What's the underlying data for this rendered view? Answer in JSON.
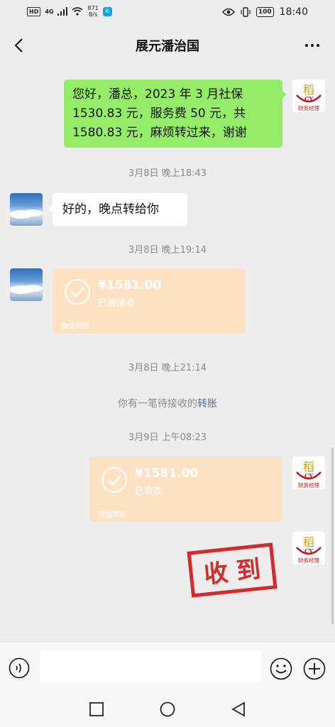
{
  "status_bar": {
    "left_badges": [
      "HD",
      "4G"
    ],
    "net_speed_value": "871",
    "net_speed_unit": "B/s",
    "battery": "100",
    "time": "18:40"
  },
  "header": {
    "title": "展元潘治国",
    "back_icon": "chevron-left-icon",
    "more_icon": "more-horizontal-icon"
  },
  "avatars": {
    "self_label": "财务经理",
    "self_logo_letters": "CY",
    "self_logo_char": "稻"
  },
  "messages": {
    "m1": {
      "line1": "您好，潘总，2023 年 3 月社保",
      "line2": "1530.83 元，服务费 50 元，共",
      "line3": "1580.83 元，麻烦转过来，谢谢"
    },
    "t1": "3月8日 晚上18:43",
    "m2": "好的，晚点转给你",
    "t2": "3月8日 晚上19:14",
    "transfer1": {
      "amount": "¥1581.00",
      "status": "已被接收",
      "footer": "微信转账"
    },
    "t3": "3月8日 晚上21:14",
    "notice": {
      "text": "你有一笔待接收的",
      "link": "转账"
    },
    "t4": "3月9日 上午08:23",
    "transfer2": {
      "amount": "¥1581.00",
      "status": "已收款",
      "footer": "微信转账"
    },
    "stamp": "收 到"
  },
  "input_bar": {
    "voice_icon": "voice-icon",
    "emoji_icon": "emoji-icon",
    "plus_icon": "plus-icon",
    "placeholder": ""
  },
  "colors": {
    "bg": "#ededed",
    "green_bubble": "#95ec69",
    "transfer_bg": "#fde1c3",
    "link": "#576b95",
    "stamp": "#d22b2b"
  }
}
